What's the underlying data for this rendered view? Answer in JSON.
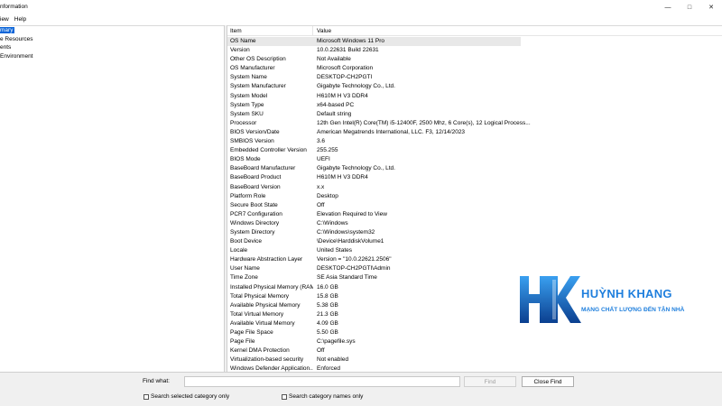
{
  "window": {
    "title": "nformation",
    "minimize_glyph": "—",
    "maximize_glyph": "□",
    "close_glyph": "✕"
  },
  "menu": [
    "iew",
    "Help"
  ],
  "tree": {
    "items": [
      {
        "label": "mary",
        "selected": true
      },
      {
        "label": "e Resources",
        "selected": false
      },
      {
        "label": "ents",
        "selected": false
      },
      {
        "label": " Environment",
        "selected": false
      }
    ]
  },
  "list": {
    "col_item": "Item",
    "col_value": "Value",
    "rows": [
      {
        "item": "OS Name",
        "value": "Microsoft Windows 11 Pro"
      },
      {
        "item": "Version",
        "value": "10.0.22631 Build 22631"
      },
      {
        "item": "Other OS Description",
        "value": "Not Available"
      },
      {
        "item": "OS Manufacturer",
        "value": "Microsoft Corporation"
      },
      {
        "item": "System Name",
        "value": "DESKTOP-CH2PGTI"
      },
      {
        "item": "System Manufacturer",
        "value": "Gigabyte Technology Co., Ltd."
      },
      {
        "item": "System Model",
        "value": "H610M H V3 DDR4"
      },
      {
        "item": "System Type",
        "value": "x64-based PC"
      },
      {
        "item": "System SKU",
        "value": "Default string"
      },
      {
        "item": "Processor",
        "value": "12th Gen Intel(R) Core(TM) i5-12400F, 2500 Mhz, 6 Core(s), 12 Logical Process..."
      },
      {
        "item": "BIOS Version/Date",
        "value": "American Megatrends International, LLC. F3, 12/14/2023"
      },
      {
        "item": "SMBIOS Version",
        "value": "3.6"
      },
      {
        "item": "Embedded Controller Version",
        "value": "255.255"
      },
      {
        "item": "BIOS Mode",
        "value": "UEFI"
      },
      {
        "item": "BaseBoard Manufacturer",
        "value": "Gigabyte Technology Co., Ltd."
      },
      {
        "item": "BaseBoard Product",
        "value": "H610M H V3 DDR4"
      },
      {
        "item": "BaseBoard Version",
        "value": "x.x"
      },
      {
        "item": "Platform Role",
        "value": "Desktop"
      },
      {
        "item": "Secure Boot State",
        "value": "Off"
      },
      {
        "item": "PCR7 Configuration",
        "value": "Elevation Required to View"
      },
      {
        "item": "Windows Directory",
        "value": "C:\\Windows"
      },
      {
        "item": "System Directory",
        "value": "C:\\Windows\\system32"
      },
      {
        "item": "Boot Device",
        "value": "\\Device\\HarddiskVolume1"
      },
      {
        "item": "Locale",
        "value": "United States"
      },
      {
        "item": "Hardware Abstraction Layer",
        "value": "Version = \"10.0.22621.2506\""
      },
      {
        "item": "User Name",
        "value": "DESKTOP-CH2PGTI\\Admin"
      },
      {
        "item": "Time Zone",
        "value": "SE Asia Standard Time"
      },
      {
        "item": "Installed Physical Memory (RAM)",
        "value": "16.0 GB"
      },
      {
        "item": "Total Physical Memory",
        "value": "15.8 GB"
      },
      {
        "item": "Available Physical Memory",
        "value": "5.38 GB"
      },
      {
        "item": "Total Virtual Memory",
        "value": "21.3 GB"
      },
      {
        "item": "Available Virtual Memory",
        "value": "4.09 GB"
      },
      {
        "item": "Page File Space",
        "value": "5.50 GB"
      },
      {
        "item": "Page File",
        "value": "C:\\pagefile.sys"
      },
      {
        "item": "Kernel DMA Protection",
        "value": "Off"
      },
      {
        "item": "Virtualization-based security",
        "value": "Not enabled"
      },
      {
        "item": "Windows Defender Application...",
        "value": "Enforced"
      }
    ]
  },
  "logo": {
    "brand": "HUỲNH KHANG",
    "tagline": "MẠNG CHẤT LƯỢNG ĐẾN TẬN NHÀ",
    "colors": {
      "primary": "#1f7fdd",
      "dark": "#0b3f8f"
    }
  },
  "find": {
    "label": "Find what:",
    "value": "",
    "find_button": "Find",
    "close_button": "Close Find",
    "check_selected": "Search selected category only",
    "check_names": "Search category names only"
  },
  "colors": {
    "selection": "#0a64d8",
    "row_highlight": "#e8e8e8",
    "toolbar_bg": "#f0f0f0"
  }
}
